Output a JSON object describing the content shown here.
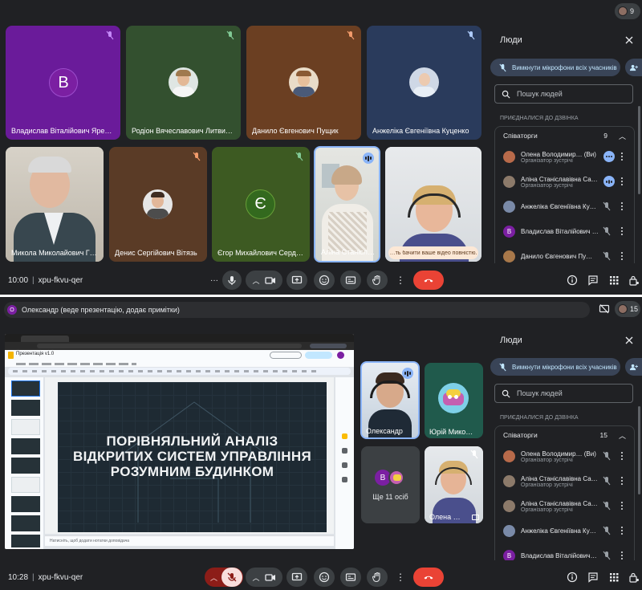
{
  "top": {
    "participant_count": "9",
    "tiles": [
      {
        "name": "Владислав Віталійович Яремч…",
        "initial": "В"
      },
      {
        "name": "Родіон Вячеславович Литвин…"
      },
      {
        "name": "Данило Євгенович Пущик"
      },
      {
        "name": "Анжеліка Євгеніївна Куценко"
      },
      {
        "name": "Микола Миколайович Г…"
      },
      {
        "name": "Денис Сергійович Вітязь"
      },
      {
        "name": "Єгор Михайлович Серд…",
        "initial": "Є"
      },
      {
        "name": "Аліна Станісл…"
      },
      {
        "toast": "…ть бачити ваше відео повністю."
      }
    ],
    "bar": {
      "time": "10:00",
      "separator": "|",
      "meeting_code": "xpu-fkvu-qer"
    },
    "panel": {
      "title": "Люди",
      "mute_all": "Вимкнути мікрофони всіх учасників",
      "search_placeholder": "Пошук людей",
      "section": "ПРИЄДНАЛИСЯ ДО ДЗВІНКА",
      "group_label": "Співаторги",
      "group_count": "9",
      "people": [
        {
          "name": "Олена Володимир… (Ви)",
          "role": "Організатор зустрічі",
          "initial": "",
          "color": "#b86a4a"
        },
        {
          "name": "Аліна Станіславівна Са…",
          "role": "Організатор зустрічі",
          "initial": "",
          "color": "#8c7a6a"
        },
        {
          "name": "Анжеліка Євгеніївна Ку…",
          "role": "",
          "initial": "",
          "color": "#7a8aa8"
        },
        {
          "name": "Владислав Віталійович …",
          "role": "",
          "initial": "В",
          "color": "#7b1fa2"
        },
        {
          "name": "Данило Євгенович Пу…",
          "role": "",
          "initial": "",
          "color": "#a8784a"
        }
      ]
    }
  },
  "bottom": {
    "presenter_initial": "О",
    "presenter_banner": "Олександр (веде презентацію, додає примітки)",
    "participant_count": "15",
    "slide": {
      "app_title": "Презентація v1.0",
      "line1": "ПОРІВНЯЛЬНИЙ АНАЛІЗ",
      "line2": "ВІДКРИТИХ СИСТЕМ УПРАВЛІННЯ",
      "line3": "РОЗУМНИМ БУДИНКОМ",
      "notes": "Натисніть, щоб додати нотатки доповідача"
    },
    "tiles": [
      {
        "name": "Олександр"
      },
      {
        "name": "Юрій Мико…"
      },
      {
        "name": "Ще 11 осіб",
        "initial": "В"
      },
      {
        "name": "Олена …"
      }
    ],
    "bar": {
      "time": "10:28",
      "separator": "|",
      "meeting_code": "xpu-fkvu-qer"
    },
    "panel": {
      "title": "Люди",
      "mute_all": "Вимкнути мікрофони всіх учасників",
      "search_placeholder": "Пошук людей",
      "section": "ПРИЄДНАЛИСЯ ДО ДЗВІНКА",
      "group_label": "Співаторги",
      "group_count": "15",
      "people": [
        {
          "name": "Олена Володимир… (Ви)",
          "role": "Організатор зустрічі",
          "initial": "",
          "color": "#b86a4a"
        },
        {
          "name": "Аліна Станіславівна Са…",
          "role": "Організатор зустрічі",
          "initial": "",
          "color": "#8c7a6a"
        },
        {
          "name": "Аліна Станіславівна Са…",
          "role": "Організатор зустрічі",
          "initial": "",
          "color": "#8c7a6a"
        },
        {
          "name": "Анжеліка Євгеніївна Ку…",
          "role": "",
          "initial": "",
          "color": "#7a8aa8"
        },
        {
          "name": "Владислав Віталійович…",
          "role": "",
          "initial": "В",
          "color": "#7b1fa2"
        }
      ]
    }
  }
}
